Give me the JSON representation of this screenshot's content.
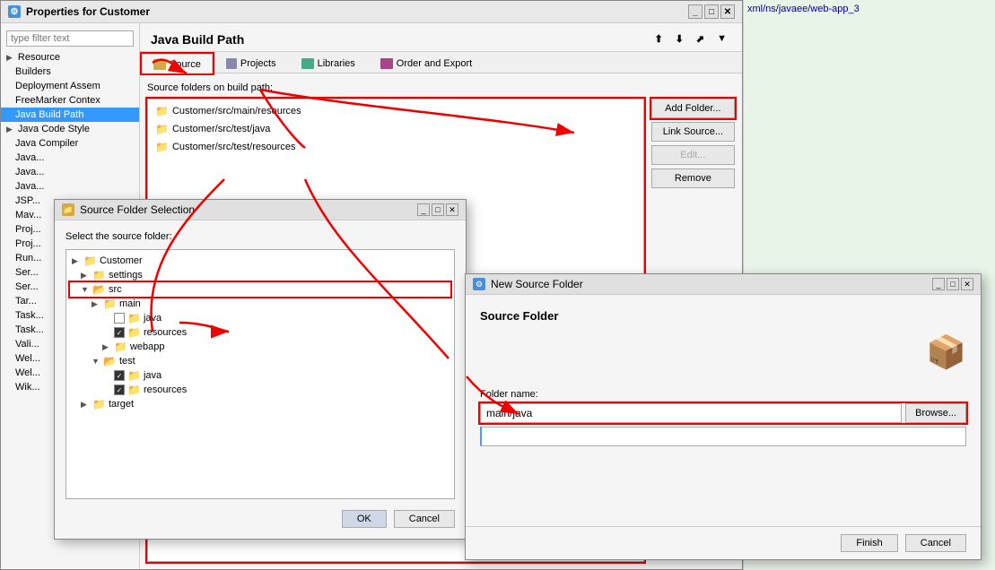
{
  "properties_window": {
    "title": "Properties for Customer",
    "filter_placeholder": "type filter text",
    "panel_title": "Java Build Path",
    "tabs": [
      {
        "label": "Source",
        "active": true,
        "icon": "source-tab-icon"
      },
      {
        "label": "Projects",
        "active": false,
        "icon": "projects-tab-icon"
      },
      {
        "label": "Libraries",
        "active": false,
        "icon": "libraries-tab-icon"
      },
      {
        "label": "Order and Export",
        "active": false,
        "icon": "order-tab-icon"
      }
    ],
    "source_label": "Source folders on build path:",
    "source_items": [
      {
        "path": "Customer/src/main/resources"
      },
      {
        "path": "Customer/src/test/java"
      },
      {
        "path": "Customer/src/test/resources"
      }
    ],
    "action_buttons": [
      {
        "label": "Add Folder...",
        "disabled": false,
        "highlighted": true
      },
      {
        "label": "Link Source...",
        "disabled": false
      },
      {
        "label": "Edit...",
        "disabled": true
      },
      {
        "label": "Remove",
        "disabled": false
      }
    ],
    "sidebar_items": [
      {
        "label": "Resource",
        "level": 1,
        "expandable": true
      },
      {
        "label": "Builders",
        "level": 1
      },
      {
        "label": "Deployment Assem",
        "level": 1
      },
      {
        "label": "FreeMarker Contex",
        "level": 1
      },
      {
        "label": "Java Build Path",
        "level": 1,
        "selected": true
      },
      {
        "label": "Java Code Style",
        "level": 1,
        "expandable": true
      },
      {
        "label": "Java Compiler",
        "level": 1
      },
      {
        "label": "Java...",
        "level": 1
      },
      {
        "label": "Java...",
        "level": 1
      },
      {
        "label": "Java...",
        "level": 1
      },
      {
        "label": "JSP...",
        "level": 1
      },
      {
        "label": "Mav...",
        "level": 1
      },
      {
        "label": "Proj...",
        "level": 1
      },
      {
        "label": "Proj...",
        "level": 1
      },
      {
        "label": "Run...",
        "level": 1
      },
      {
        "label": "Ser...",
        "level": 1
      },
      {
        "label": "Ser...",
        "level": 1
      },
      {
        "label": "Tar...",
        "level": 1
      },
      {
        "label": "Task...",
        "level": 1
      },
      {
        "label": "Task...",
        "level": 1
      },
      {
        "label": "Vali...",
        "level": 1
      },
      {
        "label": "Wel...",
        "level": 1
      },
      {
        "label": "Wel...",
        "level": 1
      },
      {
        "label": "Wik...",
        "level": 1
      }
    ]
  },
  "source_folder_dialog": {
    "title": "Source Folder Selection",
    "prompt": "Select the source folder:",
    "tree": [
      {
        "label": "Customer",
        "level": 0,
        "expanded": true,
        "toggle": "▶",
        "checkbox": false,
        "folder": true
      },
      {
        "label": "settings",
        "level": 1,
        "expanded": false,
        "toggle": "▶",
        "checkbox": false,
        "folder": true
      },
      {
        "label": "src",
        "level": 1,
        "expanded": true,
        "toggle": "▼",
        "checkbox": false,
        "folder": true,
        "highlighted": true
      },
      {
        "label": "main",
        "level": 2,
        "expanded": false,
        "toggle": "▶",
        "checkbox": false,
        "folder": true
      },
      {
        "label": "java",
        "level": 3,
        "expanded": false,
        "toggle": "",
        "checkbox": true,
        "checked": false,
        "folder": true
      },
      {
        "label": "resources",
        "level": 3,
        "expanded": false,
        "toggle": "",
        "checkbox": true,
        "checked": true,
        "folder": true
      },
      {
        "label": "webapp",
        "level": 3,
        "expanded": false,
        "toggle": "▶",
        "checkbox": false,
        "folder": true
      },
      {
        "label": "test",
        "level": 2,
        "expanded": true,
        "toggle": "▼",
        "checkbox": false,
        "folder": true
      },
      {
        "label": "java",
        "level": 3,
        "expanded": false,
        "toggle": "",
        "checkbox": true,
        "checked": true,
        "folder": true
      },
      {
        "label": "resources",
        "level": 3,
        "expanded": false,
        "toggle": "",
        "checkbox": true,
        "checked": true,
        "folder": true
      },
      {
        "label": "target",
        "level": 1,
        "expanded": false,
        "toggle": "▶",
        "checkbox": false,
        "folder": true
      }
    ],
    "footer_buttons": [
      "OK",
      "Cancel"
    ]
  },
  "new_source_folder_dialog": {
    "title": "New Source Folder",
    "section_title": "Source Folder",
    "folder_name_label": "Folder name:",
    "folder_name_value": "main/java",
    "browse_label": "Browse...",
    "footer_buttons": [
      "Finish",
      "Cancel"
    ]
  },
  "editor_area": {
    "content": "xml/ns/javaee/web-app_3"
  },
  "annotations": {
    "source_tab_arrow": "red arrow pointing to Source tab",
    "add_folder_arrow": "red arrow pointing to Add Folder button",
    "src_folder_arrow": "red arrow pointing to src in tree",
    "folder_name_arrow": "red arrow pointing to folder name input"
  }
}
